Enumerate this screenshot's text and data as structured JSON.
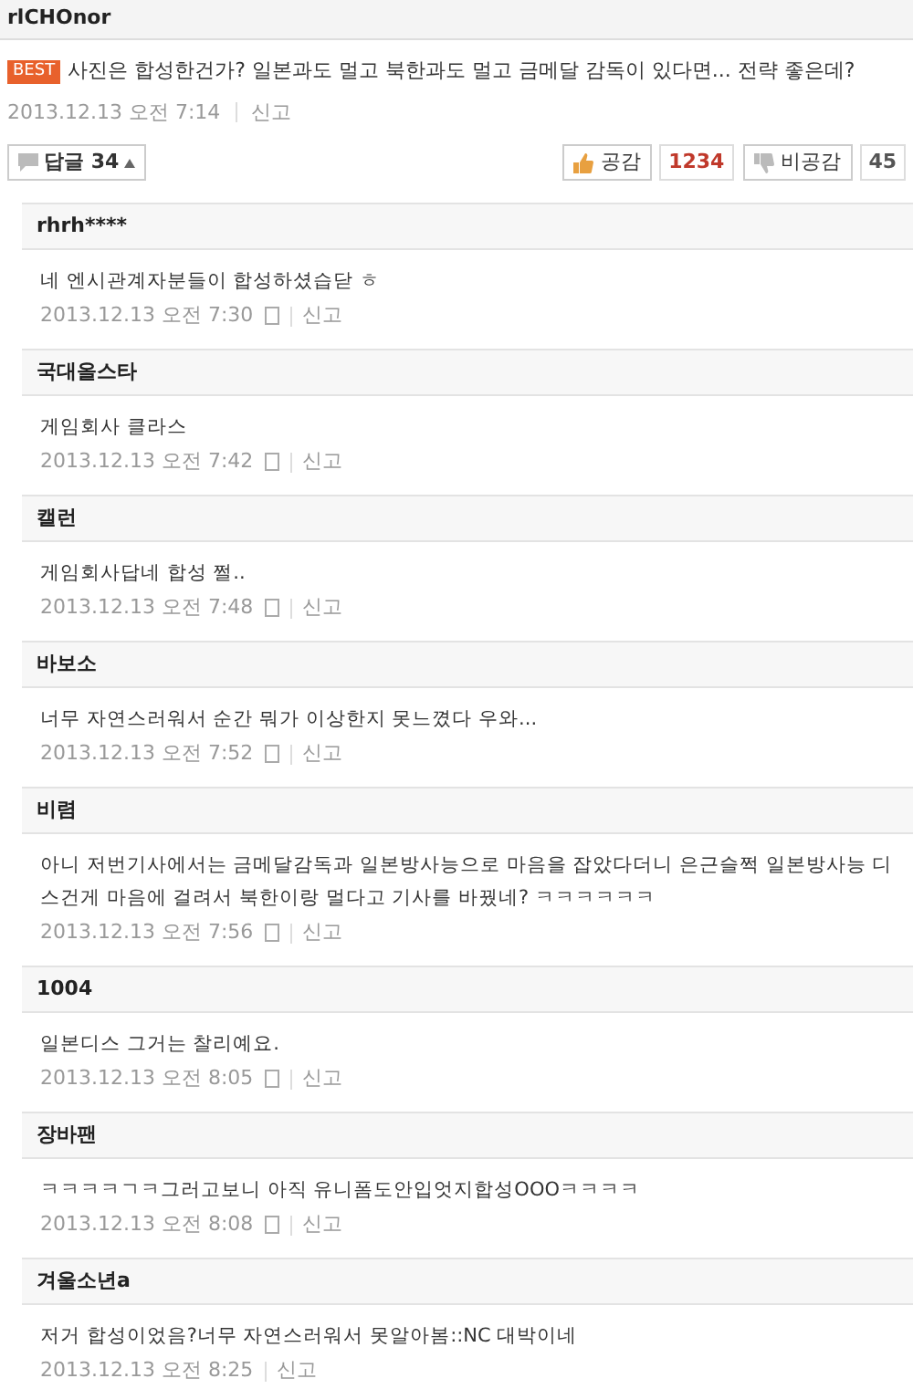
{
  "author": "rlCHOnor",
  "best": {
    "badge": "BEST",
    "text": "사진은 합성한건가? 일본과도 멀고 북한과도 멀고 금메달 감독이 있다면... 전략 좋은데?",
    "date": "2013.12.13 오전 7:14",
    "report": "신고"
  },
  "actions": {
    "replies": "답글 34",
    "expanded": true,
    "like": "공감",
    "like_count": "1234",
    "dislike": "비공감",
    "dislike_count": "45"
  },
  "replies": [
    {
      "author": "rhrh****",
      "text": "네 엔시관계자분들이 합성하셨습닫 ㅎ",
      "date": "2013.12.13 오전 7:30",
      "mobile": true,
      "report": "신고"
    },
    {
      "author": "국대올스타",
      "text": "게임회사 클라스",
      "date": "2013.12.13 오전 7:42",
      "mobile": true,
      "report": "신고"
    },
    {
      "author": "캘런",
      "text": "게임회사답네 합성 쩔..",
      "date": "2013.12.13 오전 7:48",
      "mobile": true,
      "report": "신고"
    },
    {
      "author": "바보소",
      "text": "너무 자연스러워서 순간 뭐가 이상한지 못느꼈다 우와...",
      "date": "2013.12.13 오전 7:52",
      "mobile": true,
      "report": "신고"
    },
    {
      "author": "비렴",
      "text": "아니 저번기사에서는 금메달감독과 일본방사능으로 마음을 잡았다더니 은근슬쩍 일본방사능 디스건게 마음에 걸려서 북한이랑 멀다고 기사를 바꿨네? ㅋㅋㅋㅋㅋㅋ",
      "date": "2013.12.13 오전 7:56",
      "mobile": true,
      "report": "신고"
    },
    {
      "author": "1004",
      "text": "일본디스 그거는 찰리예요.",
      "date": "2013.12.13 오전 8:05",
      "mobile": true,
      "report": "신고"
    },
    {
      "author": "장바팬",
      "text": "ㅋㅋㅋㅋㄱㅋ그러고보니 아직 유니폼도안입엇지합성OOOㅋㅋㅋㅋ",
      "date": "2013.12.13 오전 8:08",
      "mobile": true,
      "report": "신고"
    },
    {
      "author": "겨울소년a",
      "text": "저거 합성이었음?너무 자연스러워서 못알아봄::NC 대박이네",
      "date": "2013.12.13 오전 8:25",
      "mobile": false,
      "report": "신고"
    }
  ]
}
